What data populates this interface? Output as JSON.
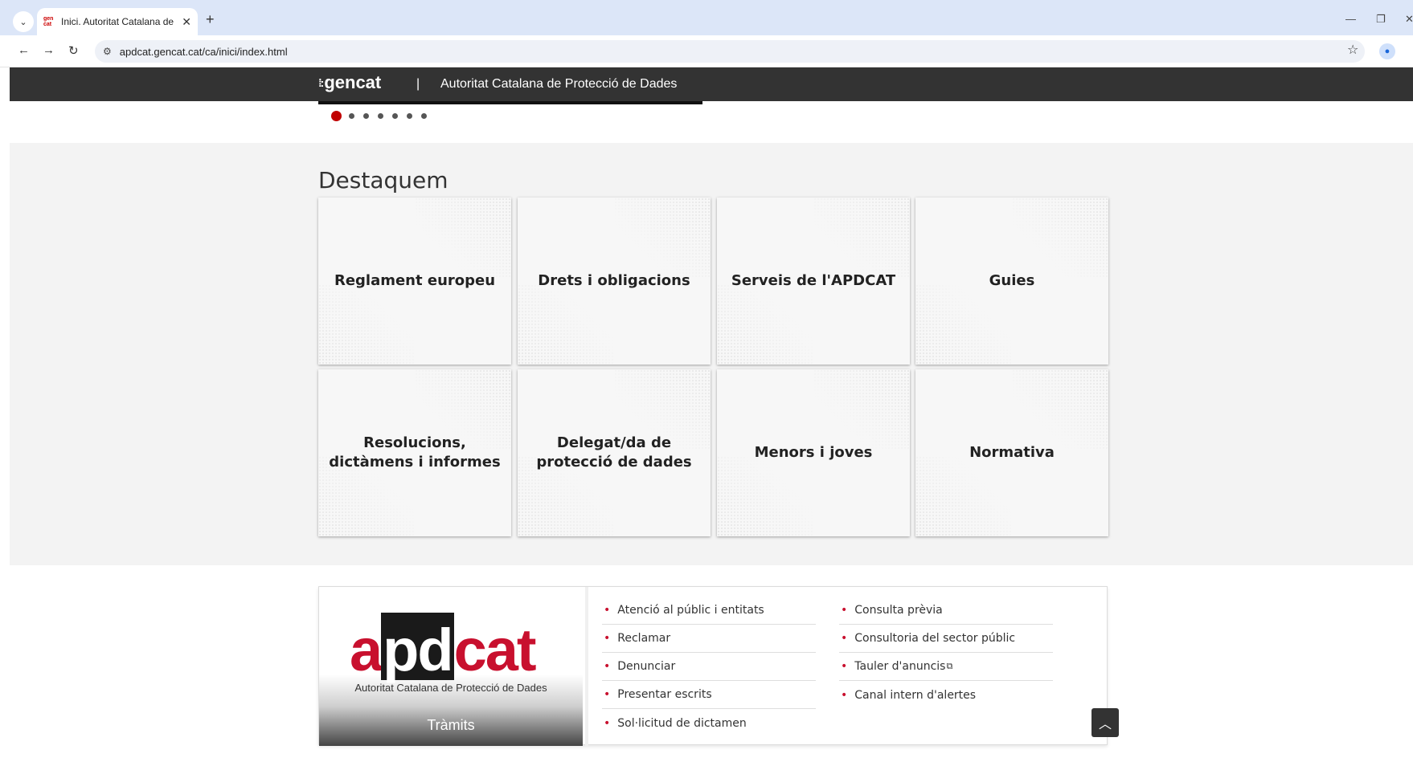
{
  "browser": {
    "tab_title": "Inici. Autoritat Catalana de Prot",
    "favicon_text": "gen cat",
    "url": "apdcat.gencat.cat/ca/inici/index.html"
  },
  "header": {
    "logo_text": "gencat",
    "separator": "|",
    "site_title": "Autoritat Catalana de Protecció de Dades"
  },
  "slider": {
    "dot_count": 7,
    "active_index": 0
  },
  "destaquem": {
    "title": "Destaquem",
    "cards": [
      {
        "label": "Reglament europeu"
      },
      {
        "label": "Drets i obligacions"
      },
      {
        "label": "Serveis de l'APDCAT"
      },
      {
        "label": "Guies"
      },
      {
        "label": "Resolucions, dictàmens i informes"
      },
      {
        "label": "Delegat/da de protecció de dades"
      },
      {
        "label": "Menors i joves"
      },
      {
        "label": "Normativa"
      }
    ]
  },
  "tramits": {
    "logo_a": "a",
    "logo_pd": "pd",
    "logo_cat": "cat",
    "logo_subtitle": "Autoritat Catalana de Protecció de Dades",
    "label": "Tràmits",
    "col1": [
      {
        "label": "Atenció al públic i entitats"
      },
      {
        "label": "Reclamar"
      },
      {
        "label": "Denunciar"
      },
      {
        "label": "Presentar escrits"
      },
      {
        "label": "Sol·licitud de dictamen"
      }
    ],
    "col2": [
      {
        "label": "Consulta prèvia"
      },
      {
        "label": "Consultoria del sector públic"
      },
      {
        "label": "Tauler d'anuncis"
      },
      {
        "label": "Canal intern d'alertes"
      }
    ]
  },
  "colors": {
    "accent": "#c8102e",
    "header_bg": "#333333",
    "section_bg": "#f3f3f3"
  }
}
